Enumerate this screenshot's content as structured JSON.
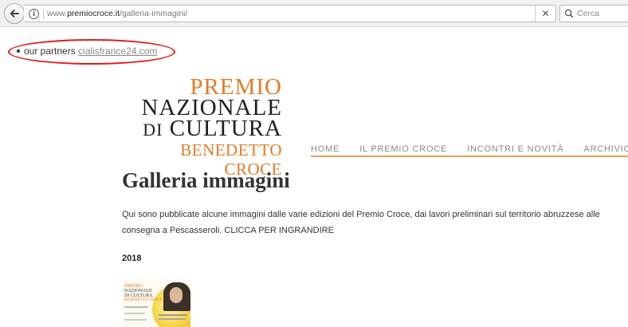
{
  "browser": {
    "url_prefix": "www.",
    "url_domain": "premiocroce.it",
    "url_path": "/galleria-immagini/",
    "clear_label": "✕",
    "search_placeholder": "Cerca"
  },
  "partners": {
    "text": "our partners",
    "link": "cialisfrance24.com"
  },
  "logo": {
    "line1": "PREMIO",
    "line2": "NAZIONALE",
    "line3_small": "DI",
    "line3": "CULTURA",
    "line4": "BENEDETTO CROCE"
  },
  "nav": {
    "items": [
      "HOME",
      "IL PREMIO CROCE",
      "INCONTRI E NOVITÀ",
      "ARCHIVIO"
    ]
  },
  "page": {
    "title": "Galleria immagini",
    "intro_line1": "Qui sono pubblicate alcune immagini dalle varie edizioni del Premio Croce, dai lavori preliminari sul territorio abruzzese alle",
    "intro_line2": "consegna a Pescasseroli. CLICCA PER INGRANDIRE",
    "year": "2018"
  },
  "colors": {
    "accent_orange": "#e57a24",
    "annotation_red": "#e01b1b"
  }
}
